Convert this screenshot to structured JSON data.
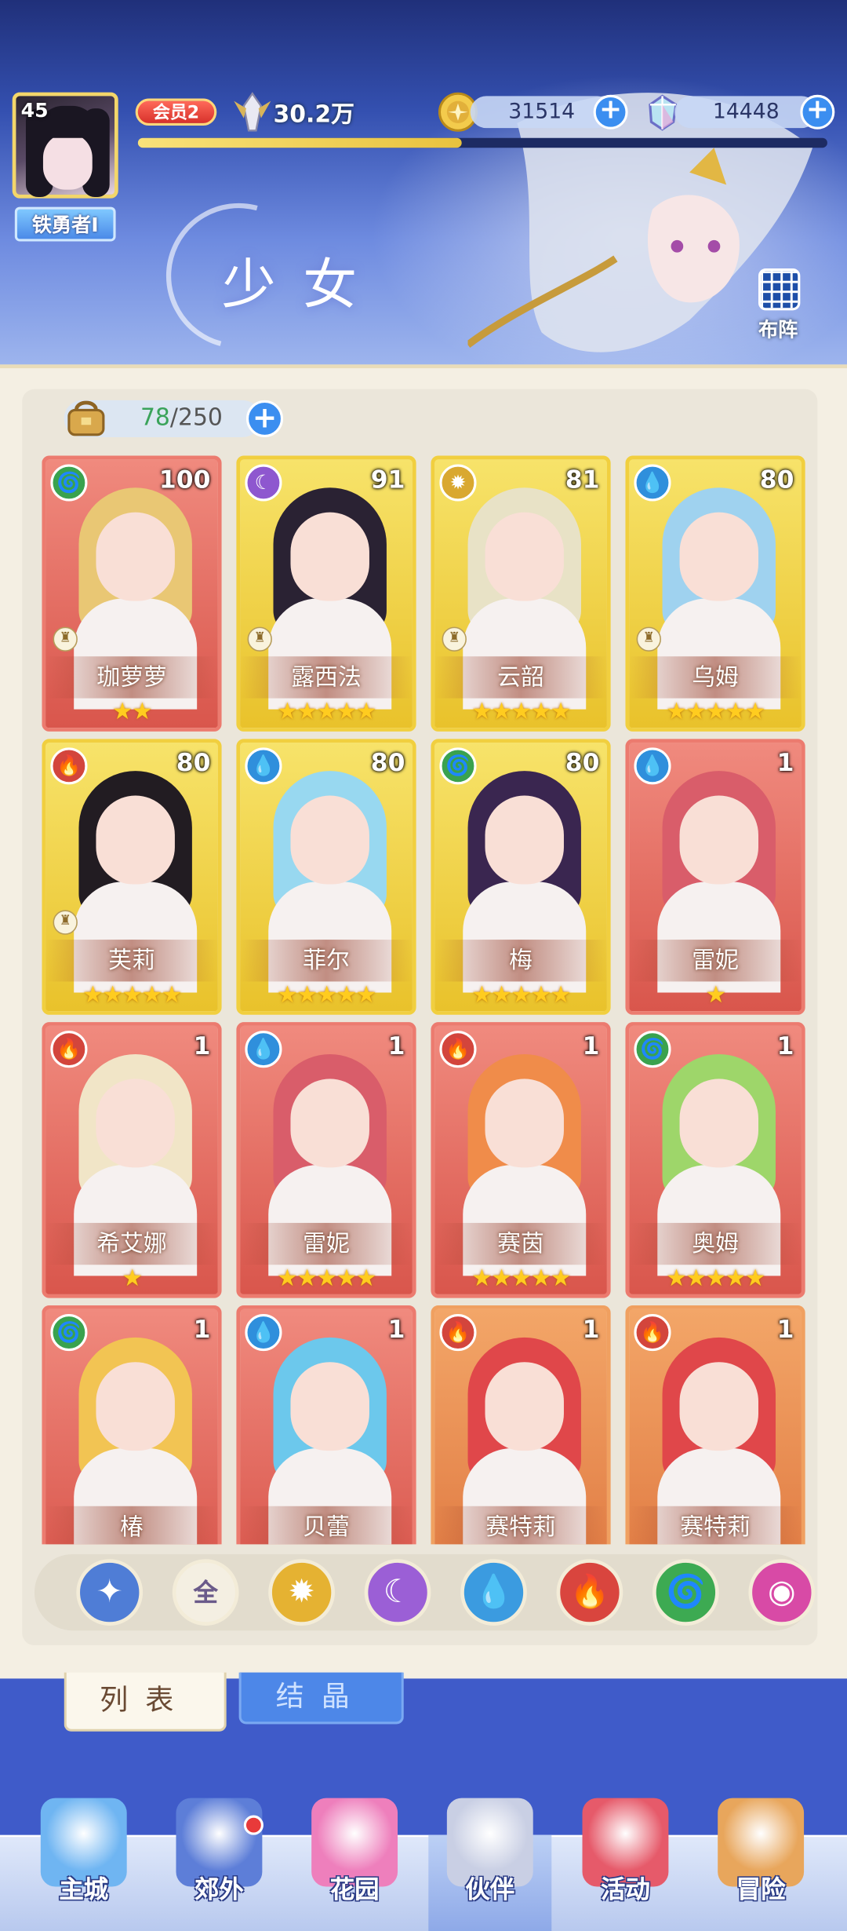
{
  "header": {
    "level": "45",
    "player_name": "铁勇者I",
    "vip": "会员2",
    "power": "30.2万",
    "exp_fraction": 0.47,
    "gold": "31514",
    "crystal": "14448",
    "section_title": "少女",
    "formation_label": "布阵"
  },
  "capacity": {
    "current": "78",
    "max": "/250"
  },
  "cards": [
    {
      "name": "珈萝萝",
      "level": "100",
      "element": "wind",
      "frame": "red",
      "stars": "★★",
      "hair": "#e9c774"
    },
    {
      "name": "露西法",
      "level": "91",
      "element": "dark",
      "frame": "gold",
      "stars": "★★★★★",
      "hair": "#2a2233"
    },
    {
      "name": "云韶",
      "level": "81",
      "element": "light",
      "frame": "gold",
      "stars": "★★★★★",
      "hair": "#e8e2c6"
    },
    {
      "name": "乌姆",
      "level": "80",
      "element": "water",
      "frame": "gold",
      "stars": "★★★★★",
      "hair": "#9fd2ef"
    },
    {
      "name": "芙莉",
      "level": "80",
      "element": "fire",
      "frame": "gold",
      "stars": "★★★★★",
      "hair": "#221c22"
    },
    {
      "name": "菲尔",
      "level": "80",
      "element": "water",
      "frame": "gold",
      "stars": "★★★★★",
      "hair": "#98d8f0"
    },
    {
      "name": "梅",
      "level": "80",
      "element": "wind",
      "frame": "gold",
      "stars": "★★★★★",
      "hair": "#3a2650"
    },
    {
      "name": "雷妮",
      "level": "1",
      "element": "water",
      "frame": "red",
      "stars": "★",
      "hair": "#d95d6a"
    },
    {
      "name": "希艾娜",
      "level": "1",
      "element": "fire",
      "frame": "red",
      "stars": "★",
      "hair": "#f1e5c7"
    },
    {
      "name": "雷妮",
      "level": "1",
      "element": "water",
      "frame": "red",
      "stars": "★★★★★",
      "hair": "#d95d6a"
    },
    {
      "name": "赛茵",
      "level": "1",
      "element": "fire",
      "frame": "red",
      "stars": "★★★★★",
      "hair": "#f08c4a"
    },
    {
      "name": "奥姆",
      "level": "1",
      "element": "wind",
      "frame": "red",
      "stars": "★★★★★",
      "hair": "#9ed66a"
    },
    {
      "name": "椿",
      "level": "1",
      "element": "wind",
      "frame": "red",
      "stars": "",
      "hair": "#f2c453"
    },
    {
      "name": "贝蕾",
      "level": "1",
      "element": "water",
      "frame": "red",
      "stars": "",
      "hair": "#6cc8ec"
    },
    {
      "name": "赛特莉",
      "level": "1",
      "element": "fire",
      "frame": "orange",
      "stars": "",
      "hair": "#e0474a"
    },
    {
      "name": "赛特莉",
      "level": "1",
      "element": "fire",
      "frame": "orange",
      "stars": "",
      "hair": "#e0474a"
    }
  ],
  "filters": [
    {
      "name": "all-elements",
      "label": "",
      "glyph": "✦",
      "color": "#4f7dd6"
    },
    {
      "name": "all",
      "label": "全",
      "glyph": "全",
      "color": "#f4efe2"
    },
    {
      "name": "light",
      "label": "",
      "glyph": "✹",
      "color": "#e5b232"
    },
    {
      "name": "dark",
      "label": "",
      "glyph": "☾",
      "color": "#9b5fd6"
    },
    {
      "name": "water",
      "label": "",
      "glyph": "💧",
      "color": "#3b9be0"
    },
    {
      "name": "fire",
      "label": "",
      "glyph": "🔥",
      "color": "#d9453e"
    },
    {
      "name": "wind",
      "label": "",
      "glyph": "🌀",
      "color": "#3daa52"
    },
    {
      "name": "special",
      "label": "",
      "glyph": "◉",
      "color": "#d84aa6"
    }
  ],
  "tabs": {
    "list": "列表",
    "crystal": "结晶"
  },
  "nav": [
    {
      "label": "主城",
      "icon": "castle-icon",
      "color": "#6fb5f2",
      "badge": false,
      "active": false
    },
    {
      "label": "郊外",
      "icon": "magic-circle-icon",
      "color": "#5d7ed8",
      "badge": true,
      "active": false
    },
    {
      "label": "花园",
      "icon": "heart-icon",
      "color": "#ee7fbc",
      "badge": false,
      "active": false
    },
    {
      "label": "伙伴",
      "icon": "partner-icon",
      "color": "#c9cfe4",
      "badge": false,
      "active": true
    },
    {
      "label": "活动",
      "icon": "gift-icon",
      "color": "#e65a6a",
      "badge": false,
      "active": false
    },
    {
      "label": "冒险",
      "icon": "compass-icon",
      "color": "#e8a65c",
      "badge": false,
      "active": false
    }
  ],
  "colors": {
    "element_wind": "#3aa24e",
    "element_dark": "#8e57cf",
    "element_light": "#d9a830",
    "element_water": "#2f8fdc",
    "element_fire": "#d3453c"
  }
}
